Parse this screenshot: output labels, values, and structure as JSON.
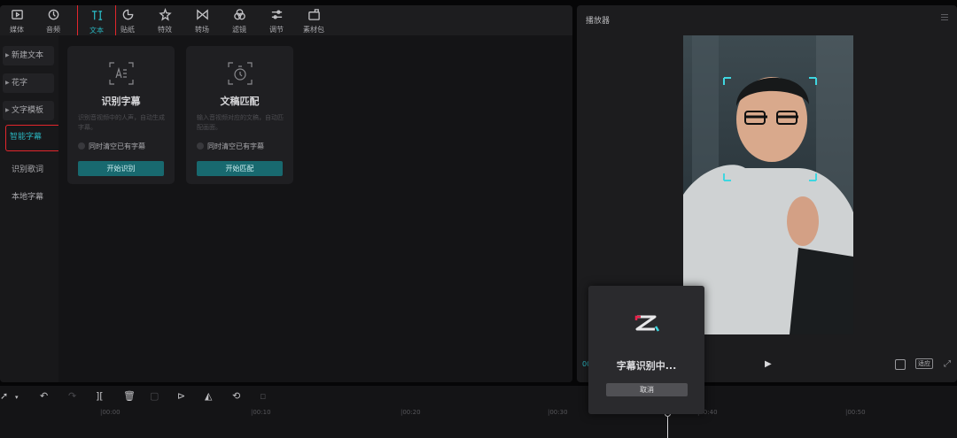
{
  "toolbar": {
    "items": [
      {
        "label": "媒体",
        "icon": "media-icon"
      },
      {
        "label": "音频",
        "icon": "audio-icon"
      },
      {
        "label": "文本",
        "icon": "text-icon"
      },
      {
        "label": "贴纸",
        "icon": "sticker-icon"
      },
      {
        "label": "特效",
        "icon": "effects-icon"
      },
      {
        "label": "转场",
        "icon": "transition-icon"
      },
      {
        "label": "滤镜",
        "icon": "filter-icon"
      },
      {
        "label": "调节",
        "icon": "adjust-icon"
      },
      {
        "label": "素材包",
        "icon": "material-pack-icon"
      }
    ],
    "active_index": 2,
    "accent_color": "#2ab3bd",
    "highlight_color": "#e3262c"
  },
  "side_nav": {
    "items": [
      {
        "label": "新建文本",
        "has_arrow": true
      },
      {
        "label": "花字",
        "has_arrow": true
      },
      {
        "label": "文字模板",
        "has_arrow": true
      },
      {
        "label": "智能字幕",
        "has_arrow": false
      },
      {
        "label": "识别歌词",
        "has_arrow": false
      },
      {
        "label": "本地字幕",
        "has_arrow": false
      }
    ],
    "active_index": 3
  },
  "cards": [
    {
      "title": "识别字幕",
      "description": "识别音视频中的人声，自动生成字幕。",
      "checkbox_label": "同时清空已有字幕",
      "button_label": "开始识别",
      "icon": "subtitle-recognize-icon"
    },
    {
      "title": "文稿匹配",
      "description": "输入音视频对应的文稿，自动匹配画面。",
      "checkbox_label": "同时清空已有字幕",
      "button_label": "开始匹配",
      "icon": "script-match-icon"
    }
  ],
  "player": {
    "title": "播放器",
    "ratio_label": "适应",
    "time_label": "00"
  },
  "timeline": {
    "ticks": [
      "|00:00",
      "|00:10",
      "|00:20",
      "|00:30",
      "|00:40",
      "|00:50"
    ]
  },
  "dialog": {
    "message": "字幕识别中...",
    "cancel_label": "取消"
  }
}
